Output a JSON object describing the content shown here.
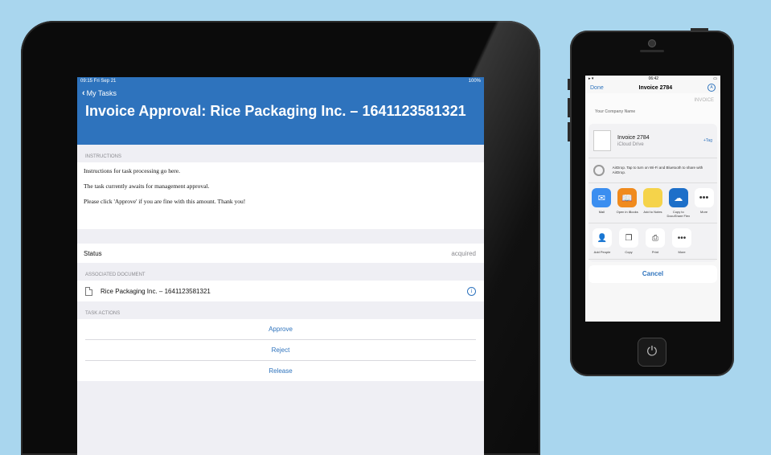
{
  "ipad": {
    "status_bar": {
      "time": "09:15  Fri Sep 21",
      "battery": "100%"
    },
    "back_label": "My Tasks",
    "title": "Invoice Approval: Rice Packaging Inc. – 1641123581321",
    "instructions": {
      "header": "INSTRUCTIONS",
      "lines": [
        "Instructions for task processing go here.",
        "The task currently awaits for management approval.",
        "Please click 'Approve' if you are fine with this amount. Thank you!"
      ]
    },
    "status": {
      "label": "Status",
      "value": "acquired"
    },
    "document": {
      "header": "ASSOCIATED DOCUMENT",
      "name": "Rice Packaging Inc. – 1641123581321"
    },
    "task_actions": {
      "header": "TASK ACTIONS",
      "items": [
        "Approve",
        "Reject",
        "Release"
      ]
    }
  },
  "iphone": {
    "status_time": "06:42",
    "nav": {
      "done": "Done",
      "title": "Invoice 2784"
    },
    "invoice_label": "INVOICE",
    "company": "Your Company Name",
    "share": {
      "file_name": "Invoice 2784",
      "file_location": "iCloud Drive",
      "tag": "+Tag",
      "airdrop_text": "AirDrop. Tap to turn on Wi-Fi and Bluetooth to share with AirDrop.",
      "apps": [
        {
          "label": "Mail",
          "color": "#3b8ef0"
        },
        {
          "label": "Open in iBooks",
          "color": "#f08a1d"
        },
        {
          "label": "Add to Notes",
          "color": "#f5d34a"
        },
        {
          "label": "Copy to DocuShare Flex",
          "color": "#1d6fc9"
        },
        {
          "label": "More",
          "color": "#ffffff"
        }
      ],
      "actions": [
        "Add People",
        "Copy",
        "Print",
        "More"
      ],
      "cancel": "Cancel"
    }
  }
}
